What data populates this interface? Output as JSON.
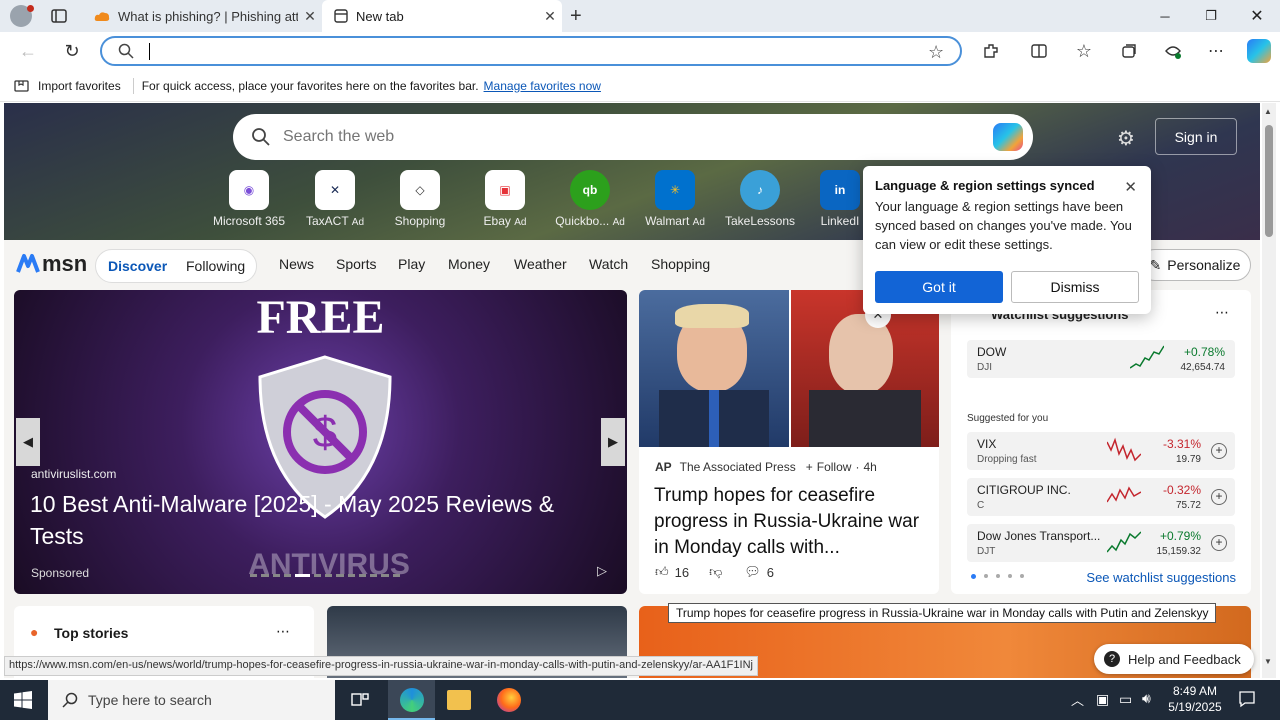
{
  "browser": {
    "tabs": [
      {
        "title": "What is phishing? | Phishing atta"
      },
      {
        "title": "New tab"
      }
    ],
    "address_value": ""
  },
  "favbar": {
    "import_label": "Import favorites",
    "hint": "For quick access, place your favorites here on the favorites bar.",
    "manage_link": "Manage favorites now"
  },
  "hero": {
    "search_placeholder": "Search the web",
    "signin": "Sign in",
    "tiles": [
      {
        "label": "Microsoft 365",
        "ad": ""
      },
      {
        "label": "TaxACT",
        "ad": "Ad"
      },
      {
        "label": "Shopping",
        "ad": ""
      },
      {
        "label": "Ebay",
        "ad": "Ad"
      },
      {
        "label": "Quickbo...",
        "ad": "Ad"
      },
      {
        "label": "Walmart",
        "ad": "Ad"
      },
      {
        "label": "TakeLessons",
        "ad": ""
      },
      {
        "label": "LinkedI",
        "ad": ""
      }
    ]
  },
  "nav": {
    "brand": "msn",
    "discover": "Discover",
    "following": "Following",
    "items": [
      "News",
      "Sports",
      "Play",
      "Money",
      "Weather",
      "Watch",
      "Shopping"
    ],
    "personalize": "Personalize"
  },
  "popup": {
    "title": "Language & region settings synced",
    "body": "Your language & region settings have been synced based on changes you've made. You can view or edit these settings.",
    "got_it": "Got it",
    "dismiss": "Dismiss"
  },
  "card1": {
    "source": "antiviruslist.com",
    "headline": "10 Best Anti-Malware [2025] - May 2025 Reviews & Tests",
    "sponsored": "Sponsored",
    "art_top": "FREE",
    "art_bottom": "ANTIVIRUS"
  },
  "card2": {
    "publisher_logo": "AP",
    "publisher": "The Associated Press",
    "follow": "Follow",
    "age": "4h",
    "headline": "Trump hopes for ceasefire progress in Russia-Ukraine war in Monday calls with...",
    "likes": "16",
    "comments": "6"
  },
  "watchlist": {
    "title": "Watchlist suggestions",
    "suggested_label": "Suggested for you",
    "see_more": "See watchlist suggestions",
    "main": {
      "name": "DOW",
      "ticker": "DJI",
      "change": "+0.78%",
      "price": "42,654.74"
    },
    "rows": [
      {
        "name": "VIX",
        "ticker": "Dropping fast",
        "change": "-3.31%",
        "price": "19.79"
      },
      {
        "name": "CITIGROUP INC.",
        "ticker": "C",
        "change": "-0.32%",
        "price": "75.72"
      },
      {
        "name": "Dow Jones Transport...",
        "ticker": "DJT",
        "change": "+0.79%",
        "price": "15,159.32"
      }
    ]
  },
  "row2": {
    "top_stories": "Top stories"
  },
  "tooltip": "Trump hopes for ceasefire progress in Russia-Ukraine war in Monday calls with Putin and Zelenskyy",
  "status_url": "https://www.msn.com/en-us/news/world/trump-hopes-for-ceasefire-progress-in-russia-ukraine-war-in-monday-calls-with-putin-and-zelenskyy/ar-AA1F1INj",
  "help": "Help and Feedback",
  "taskbar": {
    "search_placeholder": "Type here to search",
    "time": "8:49 AM",
    "date": "5/19/2025"
  }
}
